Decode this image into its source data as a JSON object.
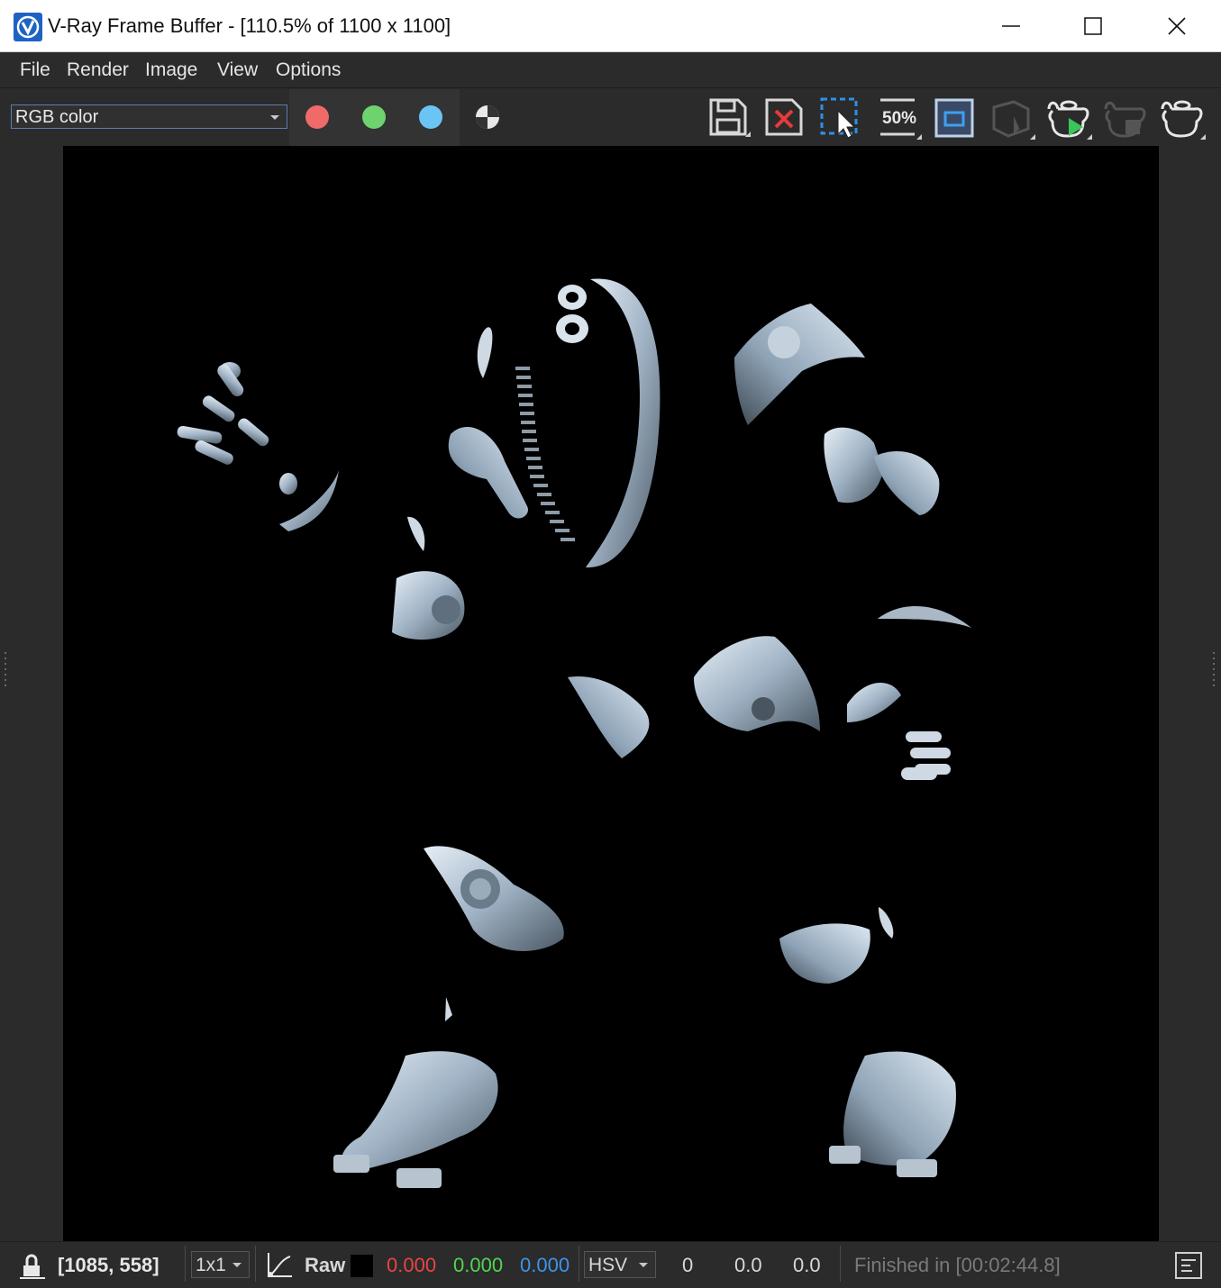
{
  "window": {
    "title": "V-Ray Frame Buffer - [110.5% of 1100 x 1100]",
    "minimize_glyph": "—",
    "maximize_glyph": "☐",
    "close_glyph": "✕"
  },
  "menu": {
    "items": [
      {
        "label": "File"
      },
      {
        "label": "Render"
      },
      {
        "label": "Image"
      },
      {
        "label": "View"
      },
      {
        "label": "Options"
      }
    ]
  },
  "toolbar": {
    "channel_select": {
      "value": "RGB color"
    },
    "channel_buttons": [
      {
        "name": "red-channel",
        "color": "#f06a6a"
      },
      {
        "name": "green-channel",
        "color": "#6ed36e"
      },
      {
        "name": "blue-channel",
        "color": "#6cc4f5"
      },
      {
        "name": "alpha-channel",
        "color": "#e8e8e8"
      }
    ],
    "tools": [
      {
        "icon": "save-icon"
      },
      {
        "icon": "clear-image-icon"
      },
      {
        "icon": "region-render-icon"
      },
      {
        "icon": "zoom-50-icon",
        "label": "50%"
      },
      {
        "icon": "frame-region-icon"
      },
      {
        "icon": "interactive-render-icon"
      },
      {
        "icon": "start-render-icon"
      },
      {
        "icon": "stop-render-icon"
      },
      {
        "icon": "render-teapot-icon"
      }
    ]
  },
  "status": {
    "coords": "[1085, 558]",
    "sample_size": "1x1",
    "color_mode": "Raw",
    "swatch_color": "#000000",
    "r": "0.000",
    "g": "0.000",
    "b": "0.000",
    "r_color": "#e84545",
    "g_color": "#4fd64f",
    "b_color": "#3d93e8",
    "hsv_mode": "HSV",
    "h": "0",
    "s": "0.0",
    "v": "0.0",
    "message": "Finished in [00:02:44.8]"
  },
  "colors": {
    "window_bg": "#2b2b2b",
    "accent": "#5b7fb0",
    "render_bg": "#000000"
  }
}
